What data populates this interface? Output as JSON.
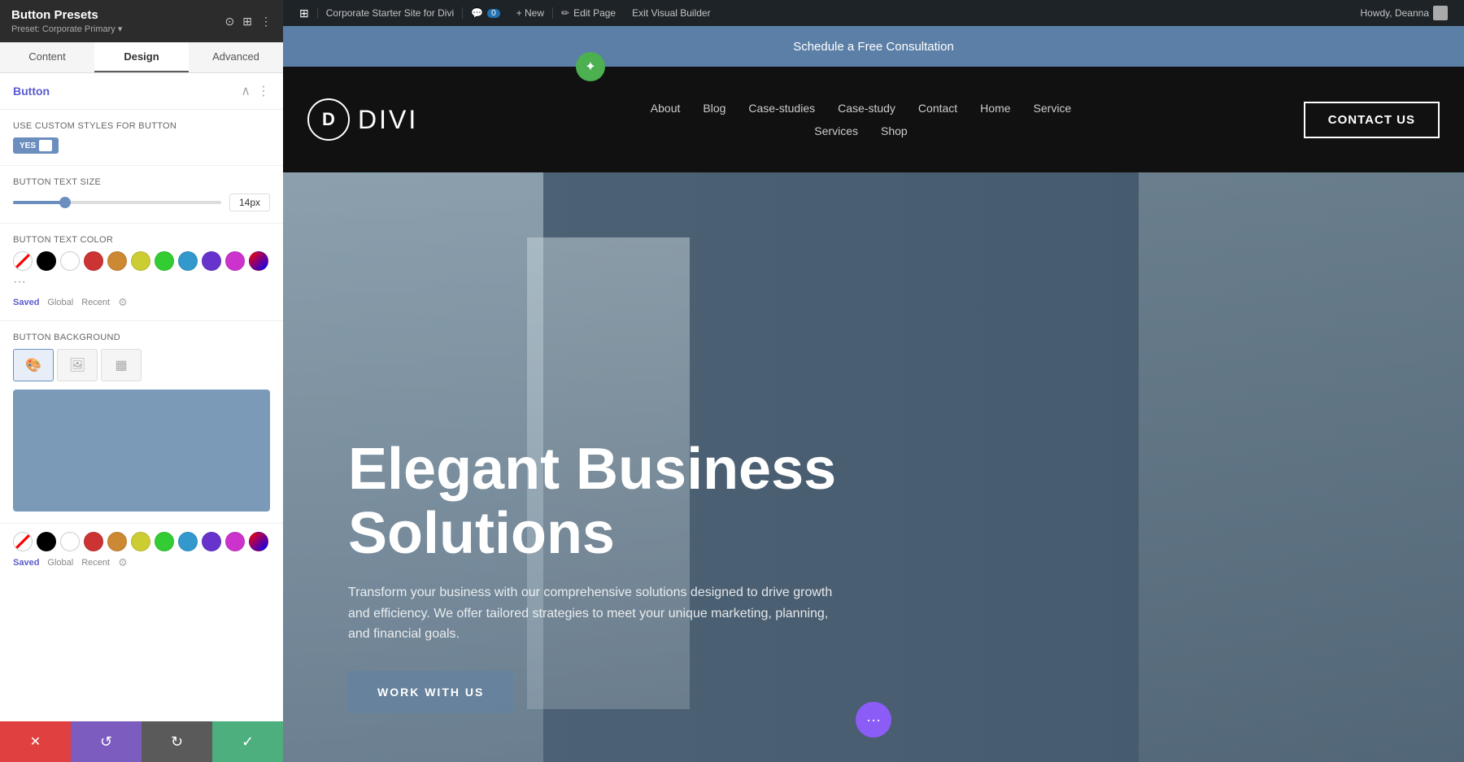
{
  "panel": {
    "title": "Button Presets",
    "subtitle": "Preset: Corporate Primary ▾",
    "tabs": [
      "Content",
      "Design",
      "Advanced"
    ],
    "active_tab": "Design",
    "section_title": "Button",
    "use_custom_label": "Use Custom Styles For Button",
    "toggle_yes": "YES",
    "button_text_size_label": "Button Text Size",
    "button_text_size_value": "14px",
    "button_text_color_label": "Button Text Color",
    "button_bg_label": "Button Background",
    "saved_label": "Saved",
    "global_label": "Global",
    "recent_label": "Recent",
    "colors": [
      "transparent",
      "#000000",
      "#ffffff",
      "#cc3333",
      "#cc8833",
      "#cccc33",
      "#33cc33",
      "#3399cc",
      "#6633cc",
      "#cc33cc"
    ],
    "colors2": [
      "transparent",
      "#000000",
      "#ffffff",
      "#cc3333",
      "#cc8833",
      "#cccc33",
      "#33cc33",
      "#3399cc",
      "#6633cc",
      "#cc33cc"
    ],
    "toolbar": {
      "cancel_icon": "✕",
      "undo_icon": "↺",
      "redo_icon": "↻",
      "confirm_icon": "✓"
    }
  },
  "wp_bar": {
    "wp_logo": "W",
    "site_name": "Corporate Starter Site for Divi",
    "comments": "0",
    "new_label": "+ New",
    "edit_page": "Edit Page",
    "exit_builder": "Exit Visual Builder",
    "howdy": "Howdy, Deanna"
  },
  "site": {
    "announcement": "Schedule a Free Consultation",
    "logo_letter": "D",
    "logo_text": "DIVI",
    "nav_links": [
      "About",
      "Blog",
      "Case-studies",
      "Case-study",
      "Contact",
      "Home",
      "Service"
    ],
    "nav_links2": [
      "Services",
      "Shop"
    ],
    "contact_btn": "CONTACT US"
  },
  "hero": {
    "title": "Elegant Business Solutions",
    "description": "Transform your business with our comprehensive solutions designed to drive growth and efficiency. We offer tailored strategies to meet your unique marketing, planning, and financial goals.",
    "cta_label": "WORK WITH US",
    "float_dots": "···"
  }
}
